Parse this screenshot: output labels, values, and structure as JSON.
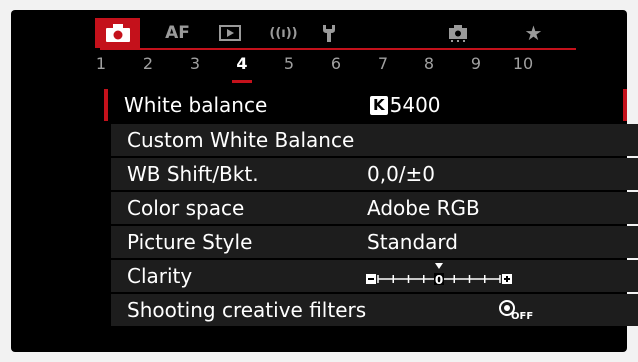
{
  "tabs": [
    {
      "icon": "camera-icon"
    },
    {
      "text": "AF"
    },
    {
      "icon": "playback-icon"
    },
    {
      "text": "((ı))",
      "icon": "wireless-icon"
    },
    {
      "icon": "wrench-icon"
    },
    {
      "icon": "custom-function-icon"
    },
    {
      "text": "★",
      "icon": "star-icon"
    }
  ],
  "pages": [
    "1",
    "2",
    "3",
    "4",
    "5",
    "6",
    "7",
    "8",
    "9",
    "10"
  ],
  "active_page": "4",
  "menu": {
    "white_balance": {
      "label": "White balance",
      "badge": "K",
      "value": "5400"
    },
    "custom_wb": {
      "label": "Custom White Balance"
    },
    "wb_shift": {
      "label": "WB Shift/Bkt.",
      "value": "0,0/±0"
    },
    "color_space": {
      "label": "Color space",
      "value": "Adobe RGB"
    },
    "picture_style": {
      "label": "Picture Style",
      "value": "Standard"
    },
    "clarity": {
      "label": "Clarity",
      "value": 0,
      "min": -4,
      "max": 4,
      "center_label": "0"
    },
    "creative_filters": {
      "label": "Shooting creative filters",
      "value_icon": "creative-filter-off-icon",
      "value": "OFF"
    }
  },
  "colors": {
    "accent": "#c4111b",
    "row": "#1d1d1d"
  }
}
